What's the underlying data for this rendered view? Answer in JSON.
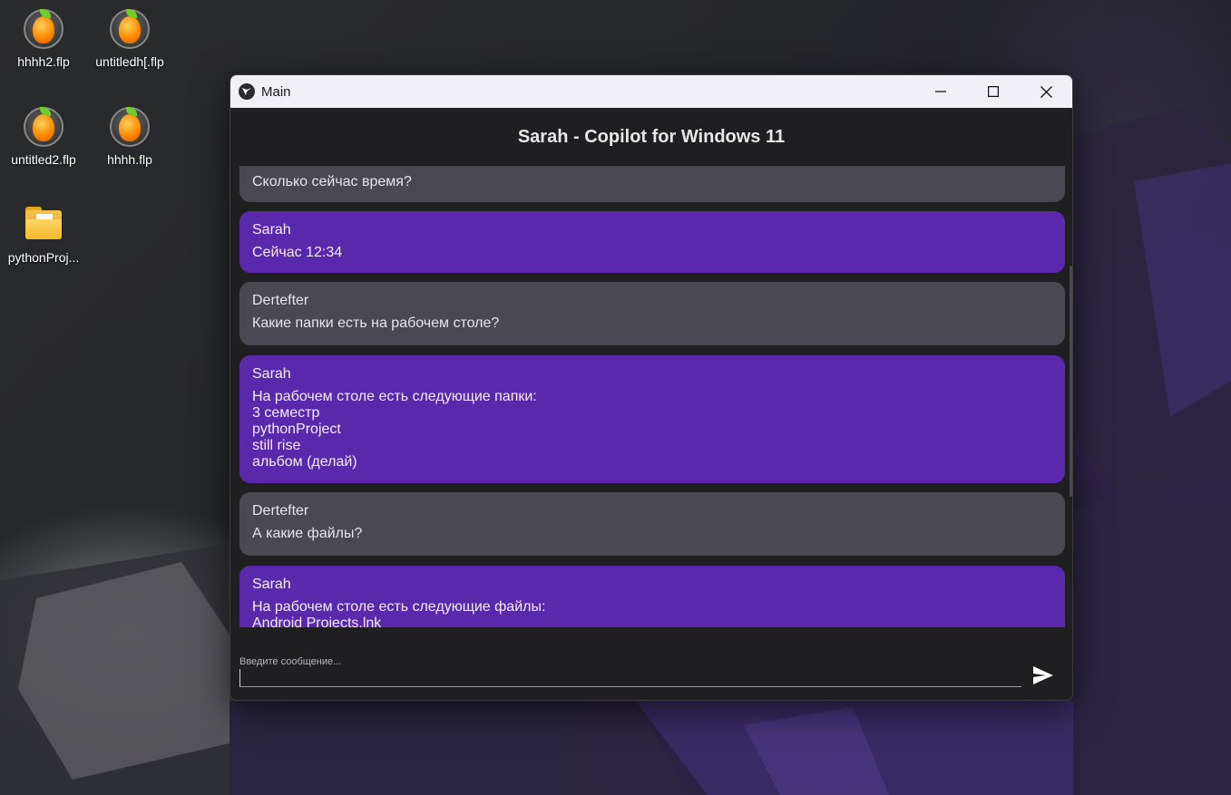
{
  "desktop": {
    "icons": [
      {
        "label": "hhhh2.flp",
        "icon": "fl-studio-icon"
      },
      {
        "label": "untitledh[.flp",
        "icon": "fl-studio-icon"
      },
      {
        "label": "untitled2.flp",
        "icon": "fl-studio-icon"
      },
      {
        "label": "hhhh.flp",
        "icon": "fl-studio-icon"
      },
      {
        "label": "pythonProj...",
        "icon": "folder-icon"
      }
    ]
  },
  "window": {
    "title": "Main",
    "controls": [
      "minimize-icon",
      "maximize-icon",
      "close-icon"
    ]
  },
  "app": {
    "header": "Sarah - Copilot for Windows 11"
  },
  "messages": [
    {
      "author": "",
      "text": "Сколько сейчас время?",
      "role": "user"
    },
    {
      "author": "Sarah",
      "text": "Сейчас 12:34",
      "role": "bot"
    },
    {
      "author": "Dertefter",
      "text": "Какие папки есть на рабочем столе?",
      "role": "user"
    },
    {
      "author": "Sarah",
      "text": "На рабочем столе есть следующие папки:\n3 семестр\npythonProject\nstill rise\nальбом (делай)",
      "role": "bot"
    },
    {
      "author": "Dertefter",
      "text": "А какие файлы?",
      "role": "user"
    },
    {
      "author": "Sarah",
      "text": "На рабочем столе есть следующие файлы:\nAndroid Projects.lnk",
      "role": "bot"
    }
  ],
  "composer": {
    "placeholder": "Введите сообщение...",
    "value": "",
    "send_icon": "send-icon"
  },
  "colors": {
    "user_bubble": "#4a4850",
    "bot_bubble": "#5a28aa",
    "window_bg": "#1f1e21",
    "titlebar_bg": "#f1f0f6"
  }
}
